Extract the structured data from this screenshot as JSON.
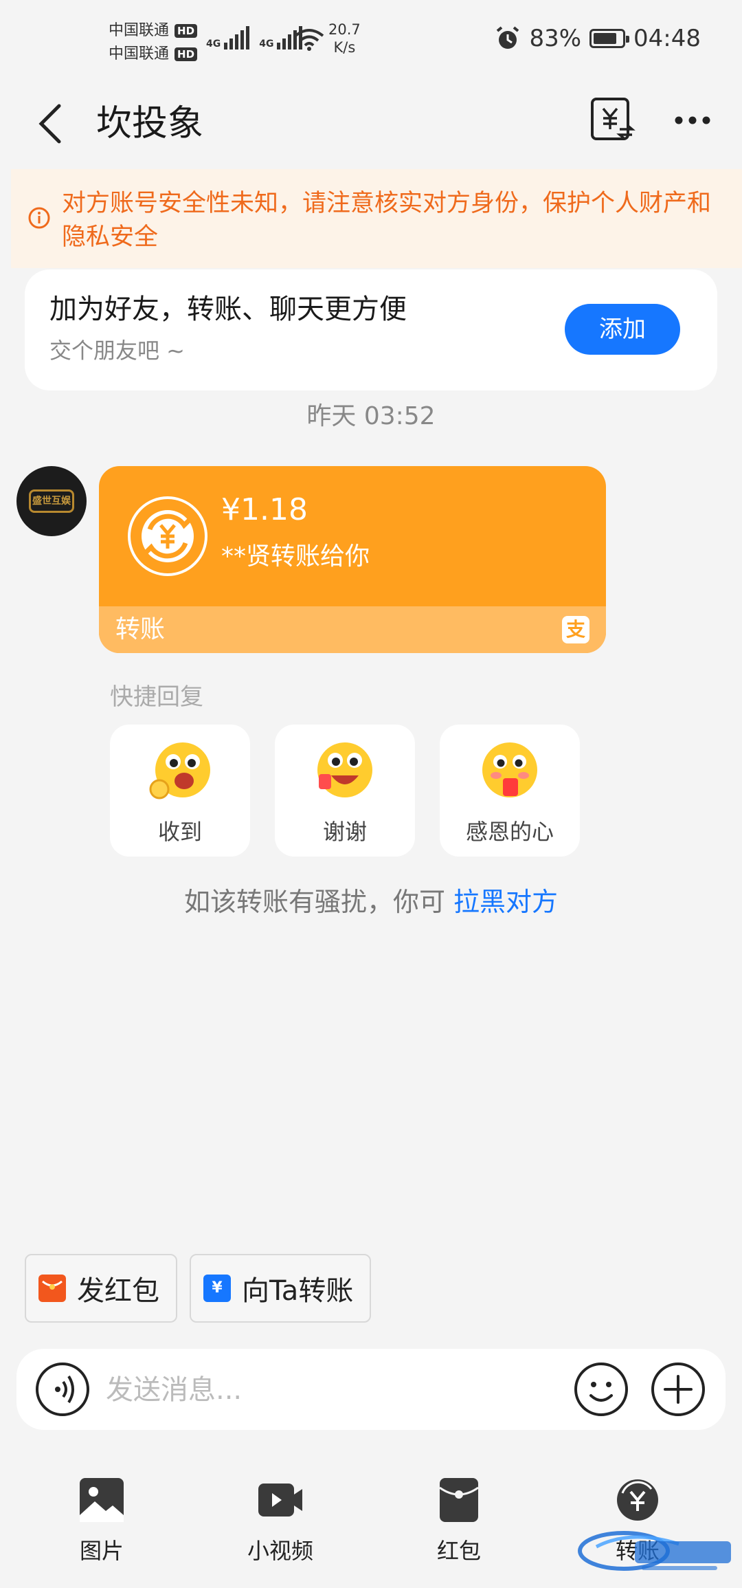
{
  "status": {
    "carrier1": "中国联通",
    "carrier2": "中国联通",
    "hd": "HD",
    "network": "4G",
    "speed_value": "20.7",
    "speed_unit": "K/s",
    "battery": "83%",
    "battery_level": 0.83,
    "time": "04:48"
  },
  "nav": {
    "title": "坎投象"
  },
  "warning": {
    "text": "对方账号安全性未知，请注意核实对方身份，保护个人财产和隐私安全"
  },
  "friend_card": {
    "title": "加为好友，转账、聊天更方便",
    "subtitle": "交个朋友吧 ~",
    "button": "添加"
  },
  "chat": {
    "timestamp": "昨天 03:52",
    "avatar_text": "盛世互娱",
    "transfer": {
      "amount": "¥1.18",
      "desc": "**贤转账给你",
      "label": "转账",
      "badge": "支"
    }
  },
  "quick_reply": {
    "title": "快捷回复",
    "items": [
      {
        "label": "收到"
      },
      {
        "label": "谢谢"
      },
      {
        "label": "感恩的心"
      }
    ]
  },
  "harass": {
    "text": "如该转账有骚扰，你可 ",
    "link": "拉黑对方"
  },
  "shortcuts": [
    {
      "label": "发红包",
      "color": "#f2571d"
    },
    {
      "label": "向Ta转账",
      "color": "#1677ff"
    }
  ],
  "input": {
    "placeholder": "发送消息..."
  },
  "tools": [
    {
      "label": "图片",
      "icon": "image-icon"
    },
    {
      "label": "小视频",
      "icon": "video-icon"
    },
    {
      "label": "红包",
      "icon": "red-packet-icon"
    },
    {
      "label": "转账",
      "icon": "transfer-icon"
    }
  ],
  "colors": {
    "accent": "#1677ff",
    "warning": "#ef6a1c",
    "bubble": "#ffa01e"
  }
}
